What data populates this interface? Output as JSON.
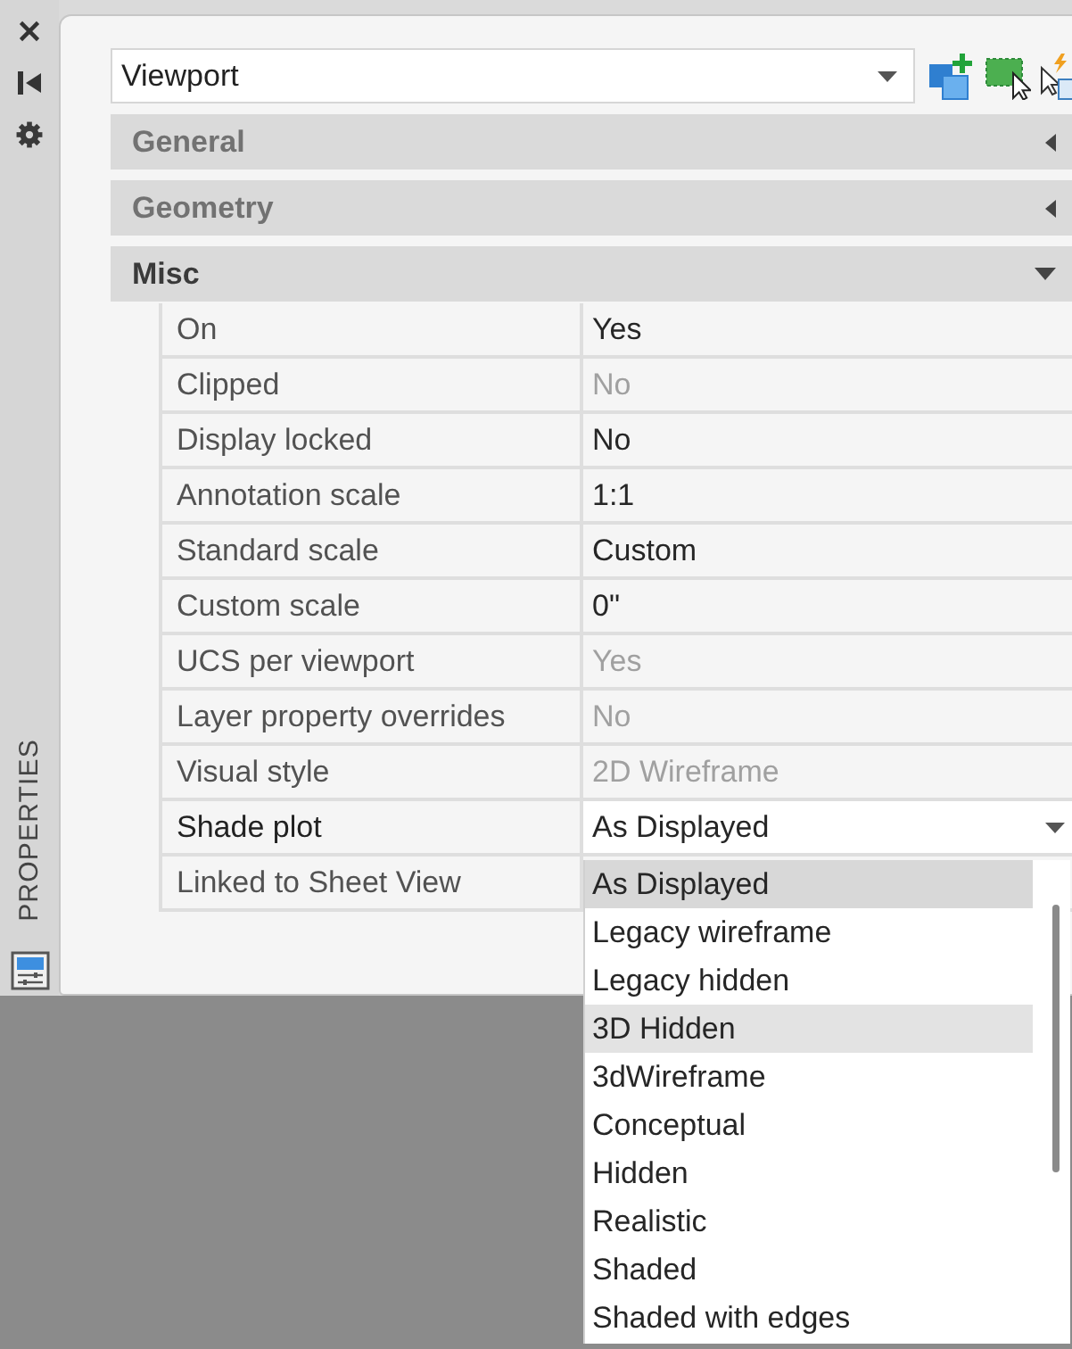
{
  "side_bar": {
    "label": "PROPERTIES"
  },
  "object_selector": {
    "value": "Viewport"
  },
  "sections": [
    {
      "title": "General",
      "expanded": false
    },
    {
      "title": "Geometry",
      "expanded": false
    },
    {
      "title": "Misc",
      "expanded": true,
      "rows": [
        {
          "name": "On",
          "value": "Yes",
          "disabled": false,
          "selected": false
        },
        {
          "name": "Clipped",
          "value": "No",
          "disabled": true,
          "selected": false
        },
        {
          "name": "Display locked",
          "value": "No",
          "disabled": false,
          "selected": false
        },
        {
          "name": "Annotation scale",
          "value": "1:1",
          "disabled": false,
          "selected": false
        },
        {
          "name": "Standard scale",
          "value": "Custom",
          "disabled": false,
          "selected": false
        },
        {
          "name": "Custom scale",
          "value": "0\"",
          "disabled": false,
          "selected": false
        },
        {
          "name": "UCS per viewport",
          "value": "Yes",
          "disabled": true,
          "selected": false
        },
        {
          "name": "Layer property overrides",
          "value": "No",
          "disabled": true,
          "selected": false
        },
        {
          "name": "Visual style",
          "value": "2D Wireframe",
          "disabled": true,
          "selected": false
        },
        {
          "name": "Shade plot",
          "value": "As Displayed",
          "disabled": false,
          "selected": true,
          "options": [
            {
              "label": "As Displayed",
              "selected": true,
              "highlighted": false
            },
            {
              "label": "Legacy wireframe",
              "selected": false,
              "highlighted": false
            },
            {
              "label": "Legacy hidden",
              "selected": false,
              "highlighted": false
            },
            {
              "label": "3D Hidden",
              "selected": false,
              "highlighted": true
            },
            {
              "label": "3dWireframe",
              "selected": false,
              "highlighted": false
            },
            {
              "label": "Conceptual",
              "selected": false,
              "highlighted": false
            },
            {
              "label": "Hidden",
              "selected": false,
              "highlighted": false
            },
            {
              "label": "Realistic",
              "selected": false,
              "highlighted": false
            },
            {
              "label": "Shaded",
              "selected": false,
              "highlighted": false
            },
            {
              "label": "Shaded with edges",
              "selected": false,
              "highlighted": false
            }
          ]
        },
        {
          "name": "Linked to Sheet View",
          "selected": false
        }
      ]
    }
  ]
}
